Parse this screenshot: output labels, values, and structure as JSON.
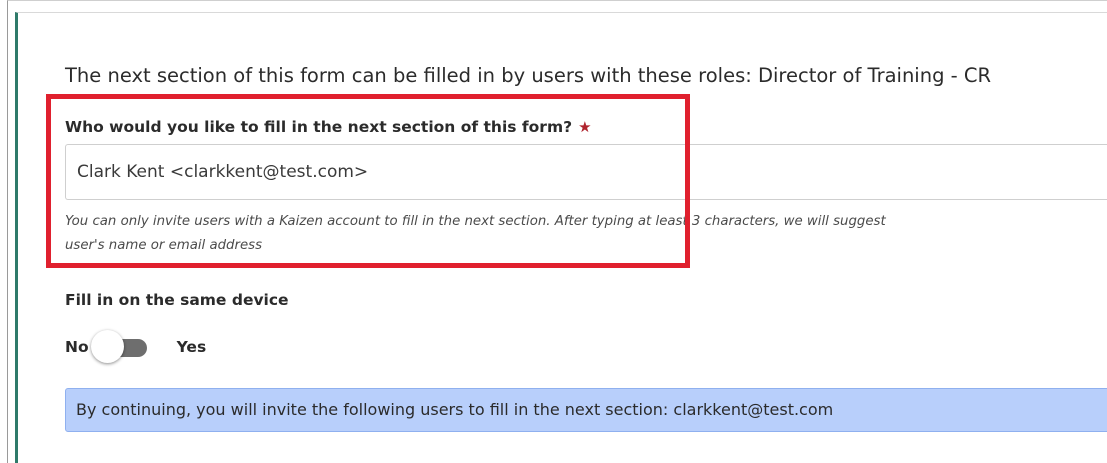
{
  "form": {
    "roles_text": "The next section of this form can be filled in by users with these roles: Director of Training - CR",
    "question_label": "Who would you like to fill in the next section of this form?",
    "required_marker": "★",
    "invitee_value": "Clark Kent <clarkkent@test.com>",
    "help_line1": "You can only invite users with a Kaizen account to fill in the next section. After typing at least 3 characters, we will suggest",
    "help_line2": "user's name or email address",
    "device_label": "Fill in on the same device",
    "toggle": {
      "off_label": "No",
      "on_label": "Yes",
      "state": "off"
    },
    "info_banner": "By continuing, you will invite the following users to fill in the next section: clarkkent@test.com"
  },
  "colors": {
    "highlight_border": "#e0202e",
    "accent_left_border": "#2f7a6a",
    "required_star": "#b0242e",
    "info_background": "#b8cffb"
  }
}
